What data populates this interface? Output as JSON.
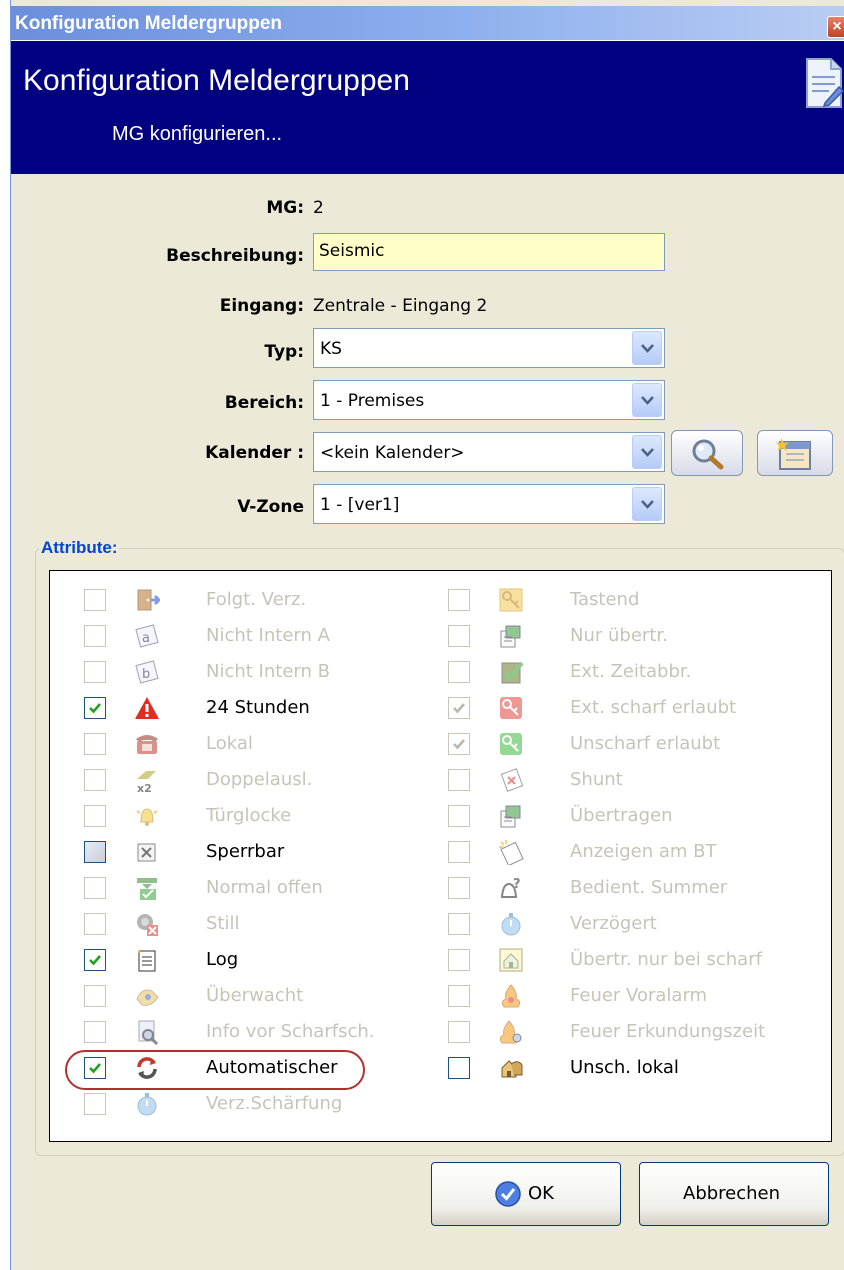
{
  "window": {
    "title": "Konfiguration Meldergruppen",
    "close_glyph": "×"
  },
  "banner": {
    "heading": "Konfiguration Meldergruppen",
    "subheading": "MG konfigurieren..."
  },
  "form": {
    "mg_label": "MG:",
    "mg_value": "2",
    "beschreibung_label": "Beschreibung:",
    "beschreibung_value": "Seismic",
    "eingang_label": "Eingang:",
    "eingang_value": "Zentrale - Eingang 2",
    "typ_label": "Typ:",
    "typ_value": "KS",
    "bereich_label": "Bereich:",
    "bereich_value": "1 - Premises",
    "kalender_label": "Kalender :",
    "kalender_value": "<kein Kalender>",
    "vzone_label": "V-Zone",
    "vzone_value": "1 - [ver1]"
  },
  "attributes": {
    "legend": "Attribute:",
    "left": [
      {
        "label": "Folgt. Verz.",
        "checked": false,
        "enabled": false,
        "icon": "door-exit-icon"
      },
      {
        "label": "Nicht Intern A",
        "checked": false,
        "enabled": false,
        "icon": "letter-a-icon"
      },
      {
        "label": "Nicht Intern B",
        "checked": false,
        "enabled": false,
        "icon": "letter-b-icon"
      },
      {
        "label": "24 Stunden",
        "checked": true,
        "enabled": true,
        "icon": "warning-triangle-icon"
      },
      {
        "label": "Lokal",
        "checked": false,
        "enabled": false,
        "icon": "phone-icon"
      },
      {
        "label": "Doppelausl.",
        "checked": false,
        "enabled": false,
        "icon": "double-trigger-icon"
      },
      {
        "label": "Türglocke",
        "checked": false,
        "enabled": false,
        "icon": "bell-icon"
      },
      {
        "label": "Sperrbar",
        "checked": false,
        "enabled": true,
        "indeterminate": true,
        "icon": "box-x-icon"
      },
      {
        "label": "Normal offen",
        "checked": false,
        "enabled": false,
        "icon": "normal-open-icon"
      },
      {
        "label": "Still",
        "checked": false,
        "enabled": false,
        "icon": "silent-icon"
      },
      {
        "label": "Log",
        "checked": true,
        "enabled": true,
        "icon": "log-document-icon"
      },
      {
        "label": "Überwacht",
        "checked": false,
        "enabled": false,
        "icon": "monitored-icon"
      },
      {
        "label": "Info vor Scharfsch.",
        "checked": false,
        "enabled": false,
        "icon": "info-search-icon"
      },
      {
        "label": "Automatischer",
        "checked": true,
        "enabled": true,
        "icon": "refresh-icon"
      },
      {
        "label": "Verz.Schärfung",
        "checked": false,
        "enabled": false,
        "icon": "timer-icon"
      }
    ],
    "right": [
      {
        "label": "Tastend",
        "checked": false,
        "enabled": false,
        "icon": "key-icon"
      },
      {
        "label": "Nur übertr.",
        "checked": false,
        "enabled": false,
        "icon": "transmit-only-icon"
      },
      {
        "label": "Ext. Zeitabbr.",
        "checked": false,
        "enabled": false,
        "icon": "time-abort-icon"
      },
      {
        "label": "Ext. scharf erlaubt",
        "checked": true,
        "enabled": false,
        "icon": "red-key-icon"
      },
      {
        "label": "Unscharf erlaubt",
        "checked": true,
        "enabled": false,
        "icon": "green-key-icon"
      },
      {
        "label": "Shunt",
        "checked": false,
        "enabled": false,
        "icon": "shunt-icon"
      },
      {
        "label": "Übertragen",
        "checked": false,
        "enabled": false,
        "icon": "transmit-icon"
      },
      {
        "label": "Anzeigen am BT",
        "checked": false,
        "enabled": false,
        "icon": "display-note-icon"
      },
      {
        "label": "Bedient. Summer",
        "checked": false,
        "enabled": false,
        "icon": "buzzer-icon"
      },
      {
        "label": "Verzögert",
        "checked": false,
        "enabled": false,
        "icon": "timer-icon"
      },
      {
        "label": "Übertr. nur bei scharf",
        "checked": false,
        "enabled": false,
        "icon": "house-icon"
      },
      {
        "label": "Feuer Voralarm",
        "checked": false,
        "enabled": false,
        "icon": "fire-prealarm-icon"
      },
      {
        "label": "Feuer Erkundungszeit",
        "checked": false,
        "enabled": false,
        "icon": "fire-investigate-icon"
      },
      {
        "label": "Unsch. lokal",
        "checked": false,
        "enabled": true,
        "icon": "local-unset-icon"
      }
    ]
  },
  "buttons": {
    "ok": "OK",
    "cancel": "Abbrechen"
  },
  "colors": {
    "banner": "#000080",
    "window": "#ece9d8",
    "field_bg": "#ffffc8",
    "legend": "#0046d5"
  }
}
